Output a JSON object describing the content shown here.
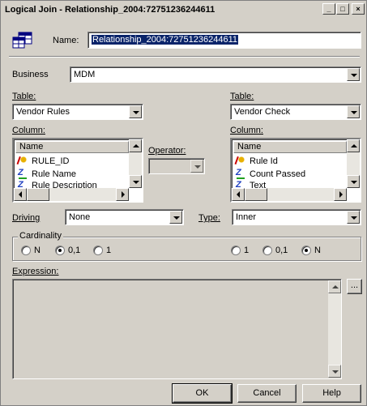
{
  "window": {
    "title": "Logical Join - Relationship_2004:72751236244611"
  },
  "name_label": "Name:",
  "name_value": "Relationship_2004:72751236244611",
  "business_label": "Business",
  "business_value": "MDM",
  "left": {
    "table_label": "Table:",
    "table_value": "Vendor Rules",
    "column_label": "Column:",
    "column_header": "Name",
    "columns": [
      {
        "icon": "key-icon",
        "label": "RULE_ID"
      },
      {
        "icon": "text-column-icon",
        "label": "Rule Name"
      },
      {
        "icon": "text-column-icon",
        "label": "Rule Description"
      }
    ]
  },
  "right": {
    "table_label": "Table:",
    "table_value": "Vendor Check",
    "column_label": "Column:",
    "column_header": "Name",
    "columns": [
      {
        "icon": "key-icon",
        "label": "Rule Id"
      },
      {
        "icon": "text-column-icon",
        "label": "Count Passed"
      },
      {
        "icon": "text-column-icon",
        "label": "Text"
      }
    ]
  },
  "operator_label": "Operator:",
  "operator_value": "",
  "driving_label": "Driving",
  "driving_value": "None",
  "type_label": "Type:",
  "type_value": "Inner",
  "cardinality": {
    "label": "Cardinality",
    "left_options": [
      {
        "label": "N",
        "selected": false
      },
      {
        "label": "0,1",
        "selected": true
      },
      {
        "label": "1",
        "selected": false
      }
    ],
    "right_options": [
      {
        "label": "1",
        "selected": false
      },
      {
        "label": "0,1",
        "selected": false
      },
      {
        "label": "N",
        "selected": true
      }
    ]
  },
  "expression_label": "Expression:",
  "expression_value": "",
  "ellipsis_label": "...",
  "buttons": {
    "ok": "OK",
    "cancel": "Cancel",
    "help": "Help"
  },
  "titlebar_buttons": {
    "minimize": "_",
    "maximize": "□",
    "close": "×"
  }
}
